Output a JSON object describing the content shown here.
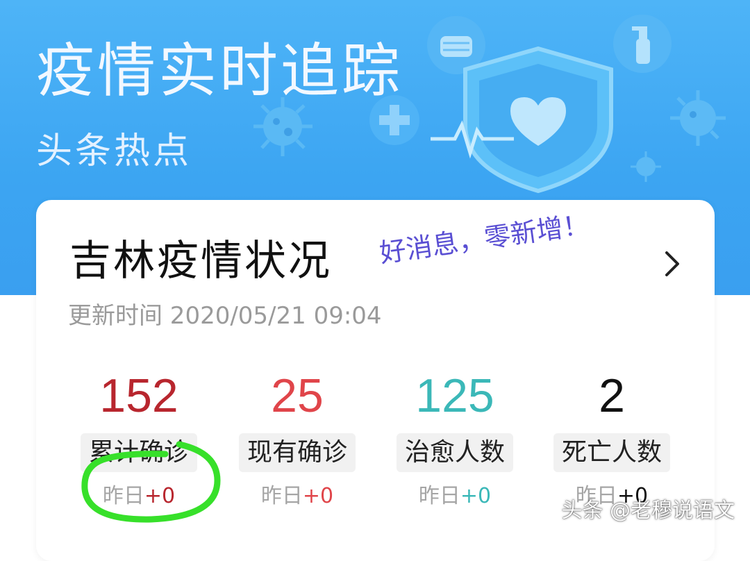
{
  "banner": {
    "title": "疫情实时追踪",
    "subtitle": "头条热点"
  },
  "card": {
    "title": "吉林疫情状况",
    "good_news": "好消息，零新增！",
    "update_time": "更新时间 2020/05/21 09:04",
    "chevron_icon": "chevron-right-icon"
  },
  "stats": [
    {
      "value": "152",
      "label": "累计确诊",
      "delta_prefix": "昨日",
      "delta": "+0",
      "color": "#b8262e"
    },
    {
      "value": "25",
      "label": "现有确诊",
      "delta_prefix": "昨日",
      "delta": "+0",
      "color": "#e0454a"
    },
    {
      "value": "125",
      "label": "治愈人数",
      "delta_prefix": "昨日",
      "delta": "+0",
      "color": "#3bb8b8"
    },
    {
      "value": "2",
      "label": "死亡人数",
      "delta_prefix": "昨日",
      "delta": "+0",
      "color": "#111111"
    }
  ],
  "watermark": "头条 @老穆说语文",
  "colors": {
    "banner": "#3ea7f2",
    "annotation_circle": "#37e02a",
    "good_news": "#5a4fd3"
  }
}
